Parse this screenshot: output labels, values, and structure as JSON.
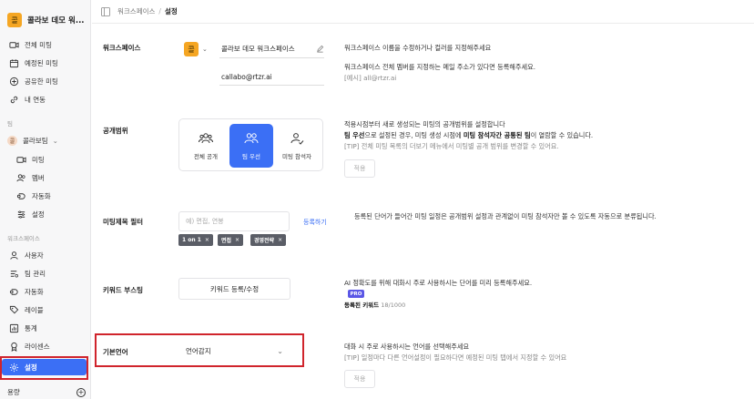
{
  "sidebar": {
    "workspace_name": "콜라보 데모 워...",
    "workspace_initial": "콜",
    "main_items": [
      {
        "label": "전체 미팅",
        "icon": "video-icon"
      },
      {
        "label": "예정된 미팅",
        "icon": "calendar-icon"
      },
      {
        "label": "공유한 미팅",
        "icon": "share-icon"
      },
      {
        "label": "내 연동",
        "icon": "link-icon"
      }
    ],
    "team_section": "팀",
    "team_name": "콜라보팀",
    "team_initial": "콜",
    "team_items": [
      {
        "label": "미팅",
        "icon": "video-icon"
      },
      {
        "label": "멤버",
        "icon": "users-icon"
      },
      {
        "label": "자동화",
        "icon": "automation-icon"
      },
      {
        "label": "설정",
        "icon": "settings-icon"
      }
    ],
    "workspace_section": "워크스페이스",
    "workspace_items": [
      {
        "label": "사용자",
        "icon": "user-icon"
      },
      {
        "label": "팀 관리",
        "icon": "team-manage-icon"
      },
      {
        "label": "자동화",
        "icon": "automation-icon"
      },
      {
        "label": "레이블",
        "icon": "label-icon"
      },
      {
        "label": "통계",
        "icon": "chart-icon"
      },
      {
        "label": "라이센스",
        "icon": "license-icon"
      },
      {
        "label": "설정",
        "icon": "settings-icon"
      }
    ],
    "bottom_label": "용량"
  },
  "header": {
    "breadcrumb_parent": "워크스페이스",
    "breadcrumb_sep": "/",
    "breadcrumb_current": "설정"
  },
  "workspace": {
    "label": "워크스페이스",
    "initial": "콜",
    "name_value": "콜라보 데모 워크스페이스",
    "email_value": "callabo@rtzr.ai",
    "desc_1": "워크스페이스 이름을 수정하거나 컬러를 지정해주세요",
    "desc_2": "워크스페이스 전체 멤버를 지정하는 메일 주소가 있다면 등록해주세요.",
    "desc_3": "[예시] all@rtzr.ai"
  },
  "scope": {
    "label": "공개범위",
    "options": [
      {
        "label": "전체 공개",
        "icon": "group-icon"
      },
      {
        "label": "팀 우선",
        "icon": "team-icon"
      },
      {
        "label": "미팅 참석자",
        "icon": "attendee-icon"
      }
    ],
    "selected_index": 1,
    "desc_1": "적용시점부터 새로 생성되는 미팅의 공개범위를 설정합니다",
    "desc_2a": "팀 우선",
    "desc_2b": "으로 설정된 경우, 미팅 생성 시점에 ",
    "desc_2c": "미팅 참석자간 공통된 팀",
    "desc_2d": "이 열람할 수 있습니다.",
    "desc_3": "[TIP] 전체 미팅 목록의 더보기 메뉴에서 미팅별 공개 범위를 변경할 수 있어요.",
    "apply_label": "적용"
  },
  "filter": {
    "label": "미팅제목 필터",
    "placeholder": "예) 면접, 연봉",
    "register_label": "등록하기",
    "chips": [
      "1 on 1",
      "면접",
      "경영전략"
    ],
    "desc": "등록된 단어가 들어간 미팅 일정은 공개범위 설정과 관계없이 미팅 참석자만 볼 수 있도록 자동으로 분류됩니다."
  },
  "boost": {
    "label": "키워드 부스팅",
    "button_label": "키워드 등록/수정",
    "desc": "AI 정확도를 위해 대화시 주로 사용하시는 단어를 미리 등록해주세요.",
    "pro_label": "PRO",
    "count_label": "등록된 키워드",
    "count_value": "18/1000"
  },
  "language": {
    "label": "기본언어",
    "selected": "언어감지",
    "desc_1": "대화 시 주로 사용하시는 언어를 선택해주세요",
    "desc_2": "[TIP] 일정마다 다른 언어설정이 필요하다면 예정된 미팅 탭에서 지정할 수 있어요",
    "apply_label": "적용"
  },
  "colors": {
    "accent": "#3b6ff5",
    "highlight_box": "#d0242c",
    "workspace_color": "#f5a623"
  }
}
